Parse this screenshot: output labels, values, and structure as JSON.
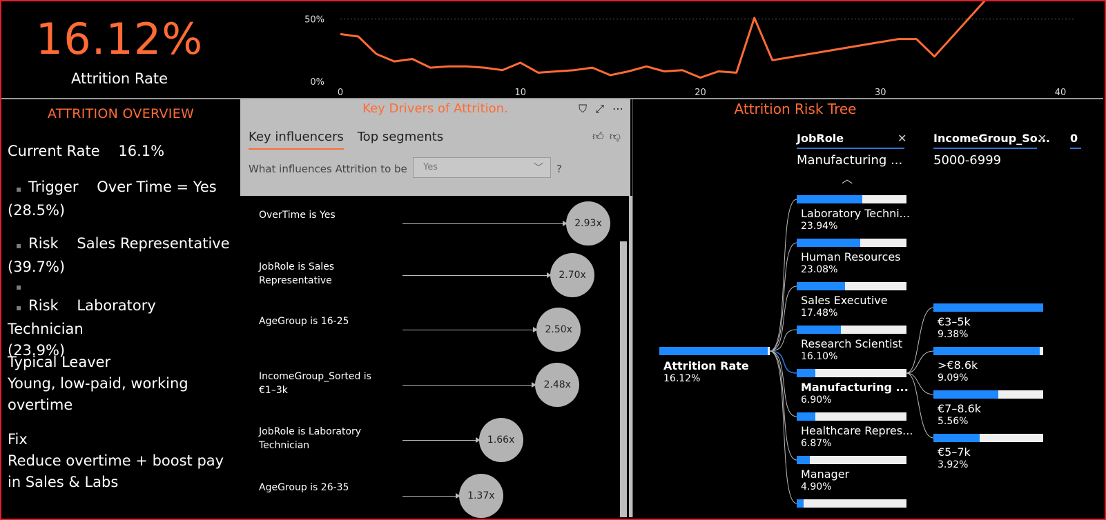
{
  "kpi": {
    "value": "16.12%",
    "label": "Attrition Rate"
  },
  "trend": {
    "chart_data": {
      "type": "line",
      "x": [
        0,
        1,
        2,
        3,
        4,
        5,
        6,
        7,
        8,
        9,
        10,
        11,
        12,
        13,
        14,
        15,
        16,
        17,
        18,
        19,
        20,
        21,
        22,
        23,
        24,
        31,
        32,
        33,
        36
      ],
      "y": [
        38,
        36,
        22,
        16,
        18,
        11,
        12,
        12,
        11,
        9,
        15,
        7,
        8,
        9,
        11,
        5,
        8,
        12,
        8,
        9,
        3,
        8,
        7,
        51,
        17,
        34,
        34,
        20,
        68
      ],
      "xticks": [
        "0",
        "10",
        "20",
        "30",
        "40"
      ],
      "yticks": [
        "0%",
        "50%"
      ],
      "xlim": [
        0,
        40
      ],
      "ylim": [
        0,
        62
      ],
      "grid": true,
      "color": "#ff6b35"
    }
  },
  "overview": {
    "title": "ATTRITION OVERVIEW",
    "current_label": "Current Rate",
    "current_value": "16.1%",
    "items": [
      {
        "key": "Trigger",
        "value": "Over Time = Yes",
        "pct": "(28.5%)"
      },
      {
        "key": "Risk",
        "value": "Sales Representative",
        "pct": "(39.7%)"
      },
      {
        "key": "Risk",
        "value": "Laboratory Technician",
        "pct": "(23.9%)"
      }
    ],
    "leaver_heading": "Typical Leaver",
    "leaver_text": "Young, low-paid, working overtime",
    "fix_heading": "Fix",
    "fix_text": "Reduce overtime + boost pay in Sales & Labs"
  },
  "key_influencers": {
    "title": "Key Drivers of Attrition.",
    "tabs": [
      "Key influencers",
      "Top segments"
    ],
    "question": "What influences Attrition to be",
    "selected": "Yes",
    "qmark": "?",
    "icons": [
      "filter-icon",
      "focus-mode-icon",
      "more-options-icon",
      "thumbs-up-icon",
      "thumbs-down-icon"
    ],
    "rows": [
      {
        "label": "OverTime is Yes",
        "value": 2.93,
        "text": "2.93x"
      },
      {
        "label": "JobRole is Sales Representative",
        "value": 2.7,
        "text": "2.70x"
      },
      {
        "label": "AgeGroup is 16-25",
        "value": 2.5,
        "text": "2.50x"
      },
      {
        "label": "IncomeGroup_Sorted is €1–3k",
        "value": 2.48,
        "text": "2.48x"
      },
      {
        "label": "JobRole is Laboratory Technician",
        "value": 1.66,
        "text": "1.66x"
      },
      {
        "label": "AgeGroup is 26-35",
        "value": 1.37,
        "text": "1.37x"
      }
    ]
  },
  "tree": {
    "title": "Attrition Risk Tree",
    "levels": [
      {
        "name": "JobRole",
        "selected": "Manufacturing ..."
      },
      {
        "name": "IncomeGroup_So...",
        "selected": "5000-6999"
      }
    ],
    "next_level_stub": "0",
    "root": {
      "name": "Attrition Rate",
      "value": "16.12%",
      "fraction": 0.98
    },
    "jobrole": [
      {
        "name": "Laboratory Techni...",
        "value": "23.94%",
        "fraction": 0.6
      },
      {
        "name": "Human Resources",
        "value": "23.08%",
        "fraction": 0.58
      },
      {
        "name": "Sales Executive",
        "value": "17.48%",
        "fraction": 0.44
      },
      {
        "name": "Research Scientist",
        "value": "16.10%",
        "fraction": 0.4
      },
      {
        "name": "Manufacturing ...",
        "value": "6.90%",
        "fraction": 0.17,
        "selected": true
      },
      {
        "name": "Healthcare Repres...",
        "value": "6.87%",
        "fraction": 0.17
      },
      {
        "name": "Manager",
        "value": "4.90%",
        "fraction": 0.12
      },
      {
        "name": "",
        "value": "",
        "fraction": 0.06
      }
    ],
    "income": [
      {
        "name": "€3–5k",
        "value": "9.38%",
        "fraction": 1.0
      },
      {
        "name": ">€8.6k",
        "value": "9.09%",
        "fraction": 0.97
      },
      {
        "name": "€7–8.6k",
        "value": "5.56%",
        "fraction": 0.59
      },
      {
        "name": "€5–7k",
        "value": "3.92%",
        "fraction": 0.42
      }
    ]
  }
}
